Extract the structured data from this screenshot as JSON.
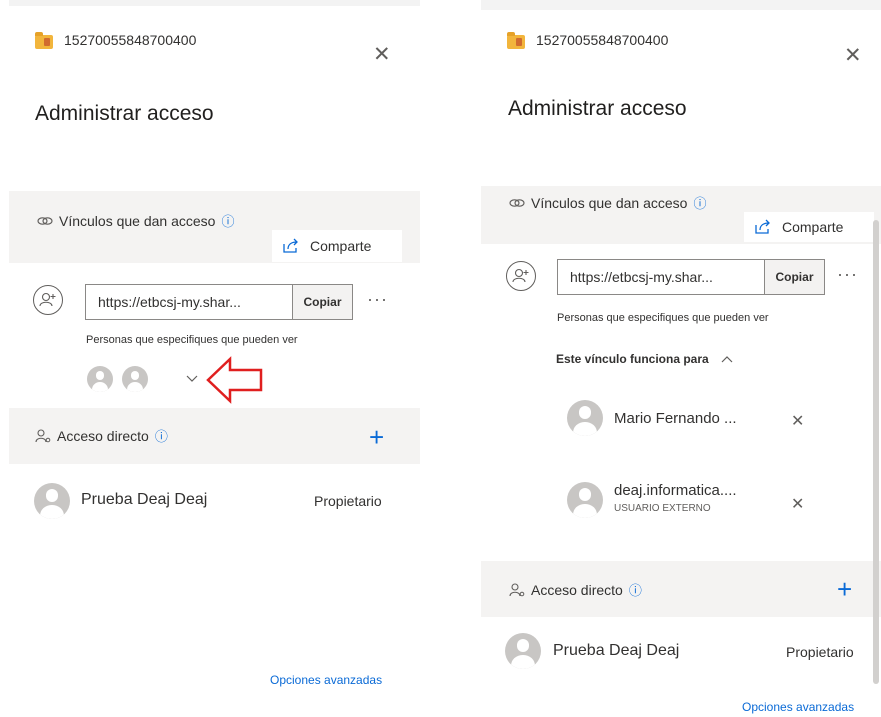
{
  "left": {
    "folder_name": "15270055848700400",
    "title": "Administrar acceso",
    "links_section_label": "Vínculos que dan acceso",
    "share_label": "Comparte",
    "link_url": "https://etbcsj-my.shar...",
    "copy_label": "Copiar",
    "more_label": "···",
    "link_scope": "Personas que especifiques que pueden ver",
    "direct_access_label": "Acceso directo",
    "owner_name": "Prueba Deaj Deaj",
    "owner_role": "Propietario",
    "advanced_label": "Opciones avanzadas"
  },
  "right": {
    "folder_name": "15270055848700400",
    "title": "Administrar acceso",
    "links_section_label": "Vínculos que dan acceso",
    "share_label": "Comparte",
    "link_url": "https://etbcsj-my.shar...",
    "copy_label": "Copiar",
    "more_label": "···",
    "link_scope": "Personas que especifiques que pueden ver",
    "works_for_label": "Este vínculo funciona para",
    "people": [
      {
        "name": "Mario Fernando ...",
        "subtitle": ""
      },
      {
        "name": "deaj.informatica....",
        "subtitle": "USUARIO EXTERNO"
      }
    ],
    "direct_access_label": "Acceso directo",
    "owner_name": "Prueba Deaj Deaj",
    "owner_role": "Propietario",
    "advanced_label": "Opciones avanzadas"
  },
  "icons": {
    "folder": "folder-shared-icon",
    "close": "close-icon",
    "link": "link-icon",
    "info": "info-icon",
    "share": "share-icon",
    "add_person": "add-person-icon",
    "chevron_down": "chevron-down-icon",
    "chevron_up": "chevron-up-icon",
    "remove": "remove-icon",
    "person": "person-icon",
    "plus": "plus-icon",
    "annotation_arrow": "arrow-left-annotation"
  },
  "colors": {
    "accent": "#0a6ad6",
    "annotation": "#e01f1f",
    "band": "#f4f3f2"
  }
}
